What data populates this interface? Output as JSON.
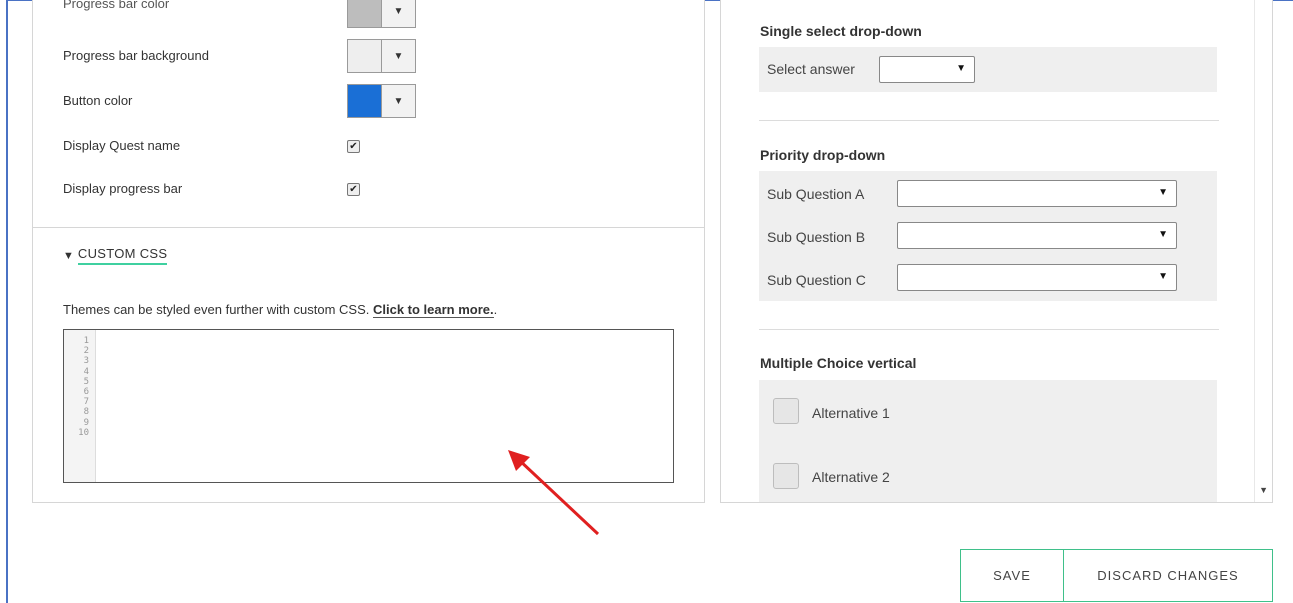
{
  "settings": {
    "progress_bar_color_label": "Progress bar color",
    "progress_bar_background_label": "Progress bar background",
    "button_color_label": "Button color",
    "display_quest_name_label": "Display Quest name",
    "display_progress_bar_label": "Display progress bar",
    "check_mark": "✔",
    "arrow_glyph": "▼",
    "colors": {
      "progress_bar_color": "#bdbdbd",
      "progress_bar_background": "#eeeeee",
      "button_color": "#1a6fd6"
    }
  },
  "custom_css": {
    "toggle_glyph": "▼",
    "heading": "CUSTOM CSS",
    "description": "Themes can be styled even further with custom CSS.",
    "learn_more": "Click to learn more.",
    "trailing": ".",
    "line_numbers": "1\n2\n3\n4\n5\n6\n7\n8\n9\n10"
  },
  "preview": {
    "single_select": {
      "title": "Single select drop-down",
      "label": "Select answer"
    },
    "priority": {
      "title": "Priority drop-down",
      "sub_a": "Sub Question A",
      "sub_b": "Sub Question B",
      "sub_c": "Sub Question C"
    },
    "multiple_choice": {
      "title": "Multiple Choice vertical",
      "alt1": "Alternative 1",
      "alt2": "Alternative 2"
    },
    "caret": "▼"
  },
  "actions": {
    "save": "SAVE",
    "discard": "DISCARD CHANGES"
  },
  "accent_colors": {
    "frame_border": "#4a72c4",
    "green_accent": "#3fc08a",
    "arrow_red": "#e02020"
  }
}
